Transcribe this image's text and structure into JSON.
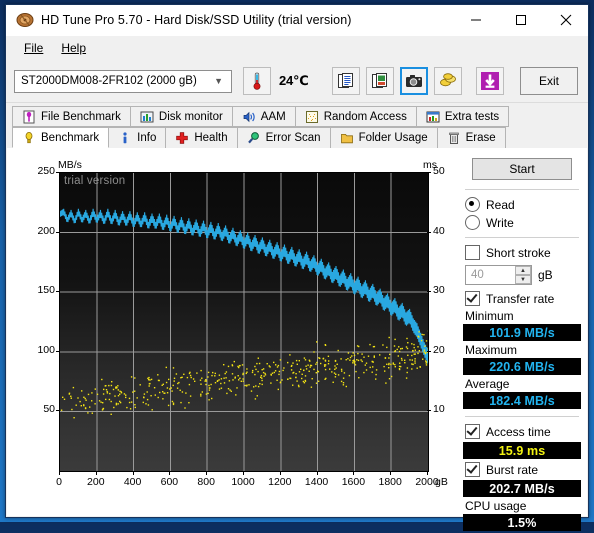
{
  "window": {
    "title": "HD Tune Pro 5.70 - Hard Disk/SSD Utility (trial version)",
    "icon": "harddisk-icon",
    "minimize_label": "minimize-icon",
    "maximize_label": "maximize-icon",
    "close_label": "close-icon"
  },
  "menu": {
    "items": [
      {
        "label": "File",
        "accel": "F"
      },
      {
        "label": "Help",
        "accel": "H"
      }
    ]
  },
  "toolbar": {
    "drive": "ST2000DM008-2FR102 (2000 gB)",
    "drive_chevron": "chevron-down-icon",
    "temperature": "24℃",
    "temperature_icon": "thermometer-icon",
    "buttons": [
      {
        "name": "copy-text-icon",
        "title": "Copy text"
      },
      {
        "name": "copy-image-icon",
        "title": "Copy image"
      },
      {
        "name": "screenshot-camera-icon",
        "title": "Save screenshot",
        "active": true
      },
      {
        "name": "coins-icon",
        "title": "Buy"
      },
      {
        "name": "download-arrow-icon",
        "title": "Download"
      }
    ],
    "exit_label": "Exit"
  },
  "tabs": {
    "top_row": [
      {
        "label": "File Benchmark",
        "icon": "file-benchmark-icon"
      },
      {
        "label": "Disk monitor",
        "icon": "bar-chart-icon"
      },
      {
        "label": "AAM",
        "icon": "speaker-icon"
      },
      {
        "label": "Random Access",
        "icon": "random-access-icon"
      },
      {
        "label": "Extra tests",
        "icon": "extra-tests-icon"
      }
    ],
    "bottom_row": [
      {
        "label": "Benchmark",
        "icon": "lightbulb-icon",
        "selected": true
      },
      {
        "label": "Info",
        "icon": "info-icon"
      },
      {
        "label": "Health",
        "icon": "health-cross-icon"
      },
      {
        "label": "Error Scan",
        "icon": "magnifier-icon"
      },
      {
        "label": "Folder Usage",
        "icon": "folder-icon"
      },
      {
        "label": "Erase",
        "icon": "trash-icon"
      }
    ]
  },
  "panel": {
    "start_label": "Start",
    "mode": {
      "read_label": "Read",
      "write_label": "Write",
      "selected": "Read"
    },
    "short_stroke": {
      "label": "Short stroke",
      "checked": false,
      "value": "40",
      "unit": "gB",
      "spin_up": "spinner-up-icon",
      "spin_down": "spinner-down-icon"
    },
    "transfer_rate": {
      "label": "Transfer rate",
      "checked": true,
      "minimum_label": "Minimum",
      "minimum_value": "101.9 MB/s",
      "maximum_label": "Maximum",
      "maximum_value": "220.6 MB/s",
      "average_label": "Average",
      "average_value": "182.4 MB/s"
    },
    "access_time": {
      "label": "Access time",
      "checked": true,
      "value": "15.9 ms"
    },
    "burst_rate": {
      "label": "Burst rate",
      "checked": true,
      "value": "202.7 MB/s"
    },
    "cpu_usage": {
      "label": "CPU usage",
      "value": "1.5%"
    },
    "colors": {
      "cyan": "#22b4f0",
      "yellow": "#f3f312",
      "white": "#ffffff",
      "accent": "#1a8fe0"
    }
  },
  "chart_data": {
    "type": "line",
    "title": "",
    "watermark": "trial version",
    "xlabel": "gB",
    "xlim": [
      0,
      2000
    ],
    "xticks": [
      0,
      200,
      400,
      600,
      800,
      1000,
      1200,
      1400,
      1600,
      1800,
      2000
    ],
    "ylabel_left": "MB/s",
    "ylim_left": [
      0,
      250
    ],
    "yticks_left": [
      0,
      50,
      100,
      150,
      200,
      250
    ],
    "ylabel_right": "ms",
    "ylim_right": [
      0,
      50
    ],
    "yticks_right": [
      0,
      10,
      20,
      30,
      40,
      50
    ],
    "grid": true,
    "series": [
      {
        "name": "Transfer rate",
        "type": "line",
        "color": "#29a8e0",
        "axis": "left",
        "unit": "MB/s",
        "x": [
          0,
          20,
          40,
          60,
          80,
          100,
          120,
          140,
          160,
          180,
          200,
          220,
          240,
          260,
          280,
          300,
          320,
          340,
          360,
          380,
          400,
          420,
          440,
          460,
          480,
          500,
          520,
          540,
          560,
          580,
          600,
          620,
          640,
          660,
          680,
          700,
          720,
          740,
          760,
          780,
          800,
          820,
          840,
          860,
          880,
          900,
          920,
          940,
          960,
          980,
          1000,
          1020,
          1040,
          1060,
          1080,
          1100,
          1120,
          1140,
          1160,
          1180,
          1200,
          1220,
          1240,
          1260,
          1280,
          1300,
          1320,
          1340,
          1360,
          1380,
          1400,
          1420,
          1440,
          1460,
          1480,
          1500,
          1520,
          1540,
          1560,
          1580,
          1600,
          1620,
          1640,
          1660,
          1680,
          1700,
          1720,
          1740,
          1760,
          1780,
          1800,
          1820,
          1840,
          1860,
          1880,
          1900,
          1920,
          1940,
          1960,
          1980,
          2000
        ],
        "y": [
          218,
          220,
          213,
          219,
          212,
          220,
          213,
          219,
          212,
          220,
          213,
          219,
          212,
          220,
          212,
          219,
          211,
          218,
          211,
          218,
          210,
          217,
          210,
          217,
          209,
          216,
          209,
          216,
          208,
          215,
          207,
          214,
          206,
          213,
          205,
          212,
          204,
          211,
          203,
          210,
          202,
          209,
          201,
          208,
          200,
          206,
          198,
          204,
          196,
          202,
          194,
          200,
          192,
          198,
          190,
          196,
          188,
          194,
          186,
          192,
          184,
          190,
          182,
          188,
          180,
          186,
          178,
          184,
          176,
          181,
          173,
          178,
          170,
          175,
          167,
          172,
          164,
          169,
          161,
          166,
          158,
          163,
          155,
          160,
          152,
          157,
          149,
          153,
          145,
          149,
          141,
          145,
          137,
          141,
          133,
          136,
          128,
          124,
          116,
          108,
          102
        ]
      },
      {
        "name": "Access time",
        "type": "scatter",
        "color": "#f3e313",
        "axis": "right",
        "unit": "ms",
        "average": 15.9,
        "range_ms": [
          8,
          26
        ],
        "point_count": 520,
        "note": "Yellow scatter rising from ~10 ms near 0 gB to ~24 ms near 2000 gB"
      }
    ]
  }
}
